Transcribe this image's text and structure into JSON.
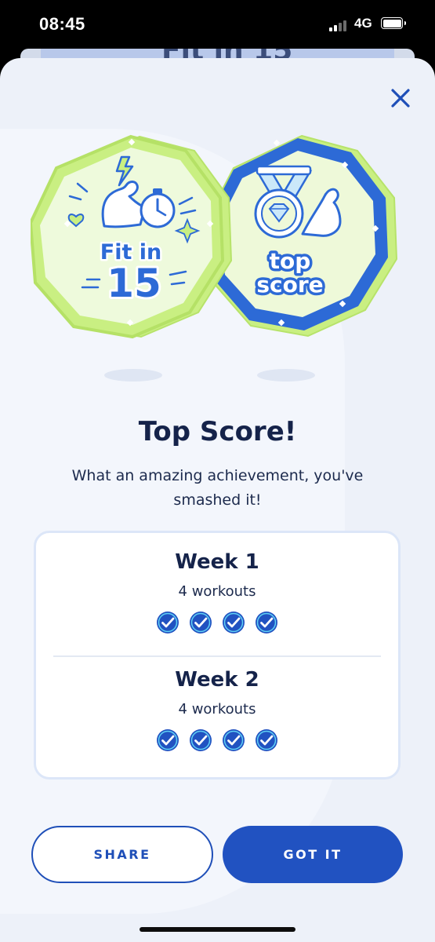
{
  "status_bar": {
    "time": "08:45",
    "network": "4G"
  },
  "background_card": {
    "peek_text": "Fit in 15"
  },
  "badges": {
    "left": {
      "line1": "Fit in",
      "line2": "15"
    },
    "right": {
      "line1": "top",
      "line2": "score"
    }
  },
  "modal": {
    "title": "Top Score!",
    "subtitle": "What an amazing achievement, you've smashed it!"
  },
  "weeks": [
    {
      "title": "Week 1",
      "subtitle": "4 workouts",
      "completed": 4
    },
    {
      "title": "Week 2",
      "subtitle": "4 workouts",
      "completed": 4
    }
  ],
  "buttons": {
    "share": "SHARE",
    "got_it": "GOT IT"
  },
  "colors": {
    "primary": "#2152c1",
    "navy": "#15234a",
    "lime": "#c8f07a",
    "lime_light": "#eefadc",
    "sheet_bg": "#edf1f9"
  },
  "icons": {
    "close": "close-icon",
    "check": "check-circle-icon",
    "medal": "medal-icon",
    "bicep": "bicep-icon",
    "stopwatch": "stopwatch-icon",
    "lightning": "lightning-icon",
    "heart": "heart-icon",
    "diamond": "diamond-icon"
  }
}
